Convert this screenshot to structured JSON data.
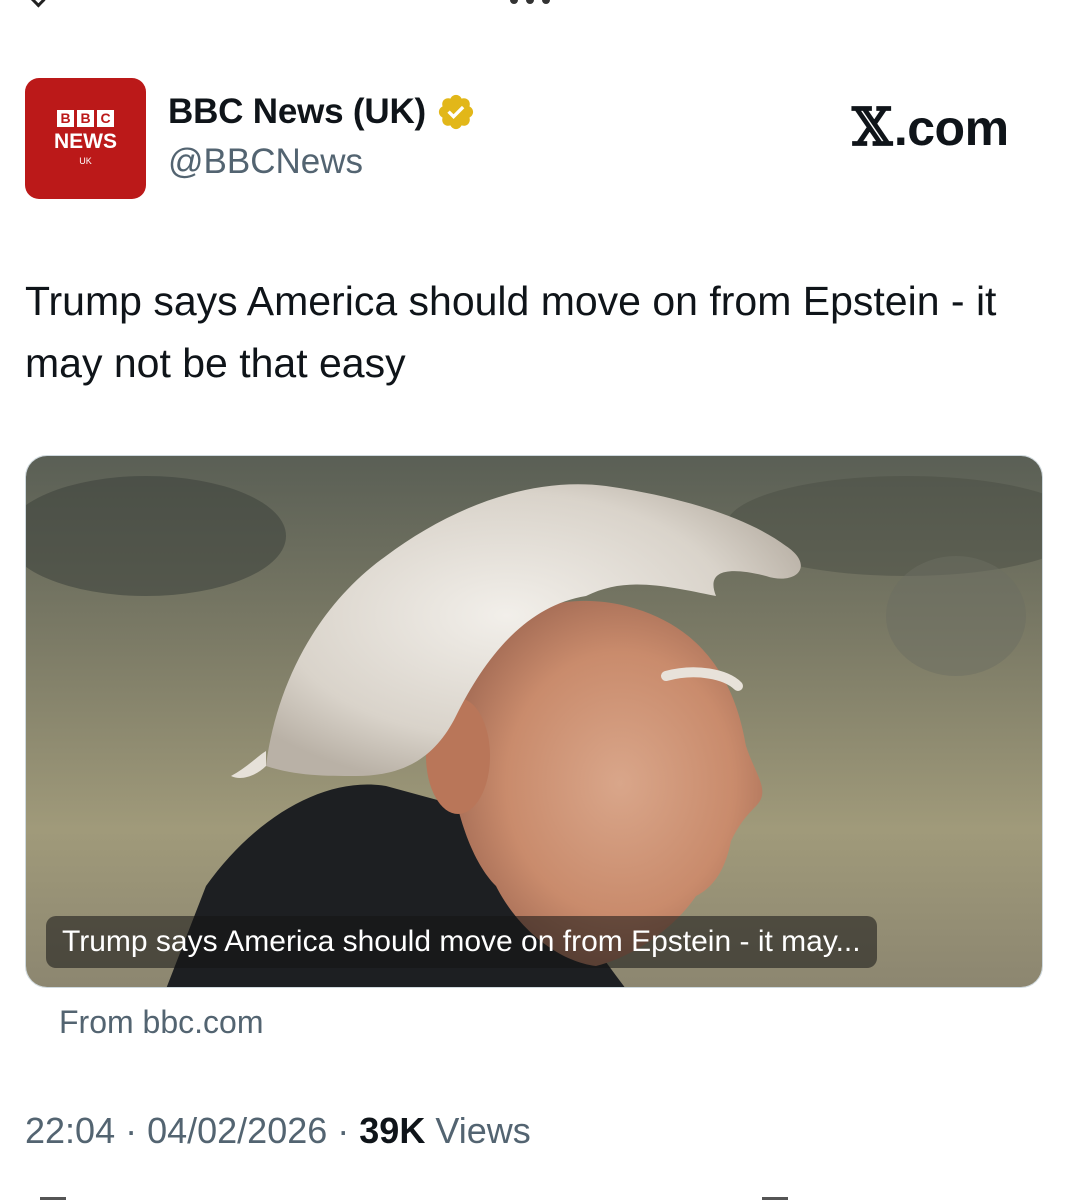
{
  "account": {
    "avatar_top": [
      "B",
      "B",
      "C"
    ],
    "avatar_middle": "NEWS",
    "avatar_bottom": "UK",
    "display_name": "BBC News (UK)",
    "handle": "@BBCNews",
    "verified": true
  },
  "branding": {
    "site": ".com",
    "site_glyph": "𝕏"
  },
  "tweet": {
    "text": "Trump says America should move on from Epstein - it may not be that easy"
  },
  "card": {
    "headline": "Trump says America should move on from Epstein - it may...",
    "source": "From bbc.com"
  },
  "meta": {
    "time": "22:04",
    "sep1": " · ",
    "date": "04/02/2026",
    "sep2": " · ",
    "views_count": "39K",
    "views_label": " Views"
  },
  "colors": {
    "bbc_red": "#bb1919",
    "verified_gold": "#e2b719",
    "secondary_text": "#536471"
  },
  "icons": [
    "verified-badge-icon",
    "x-logo-icon"
  ]
}
